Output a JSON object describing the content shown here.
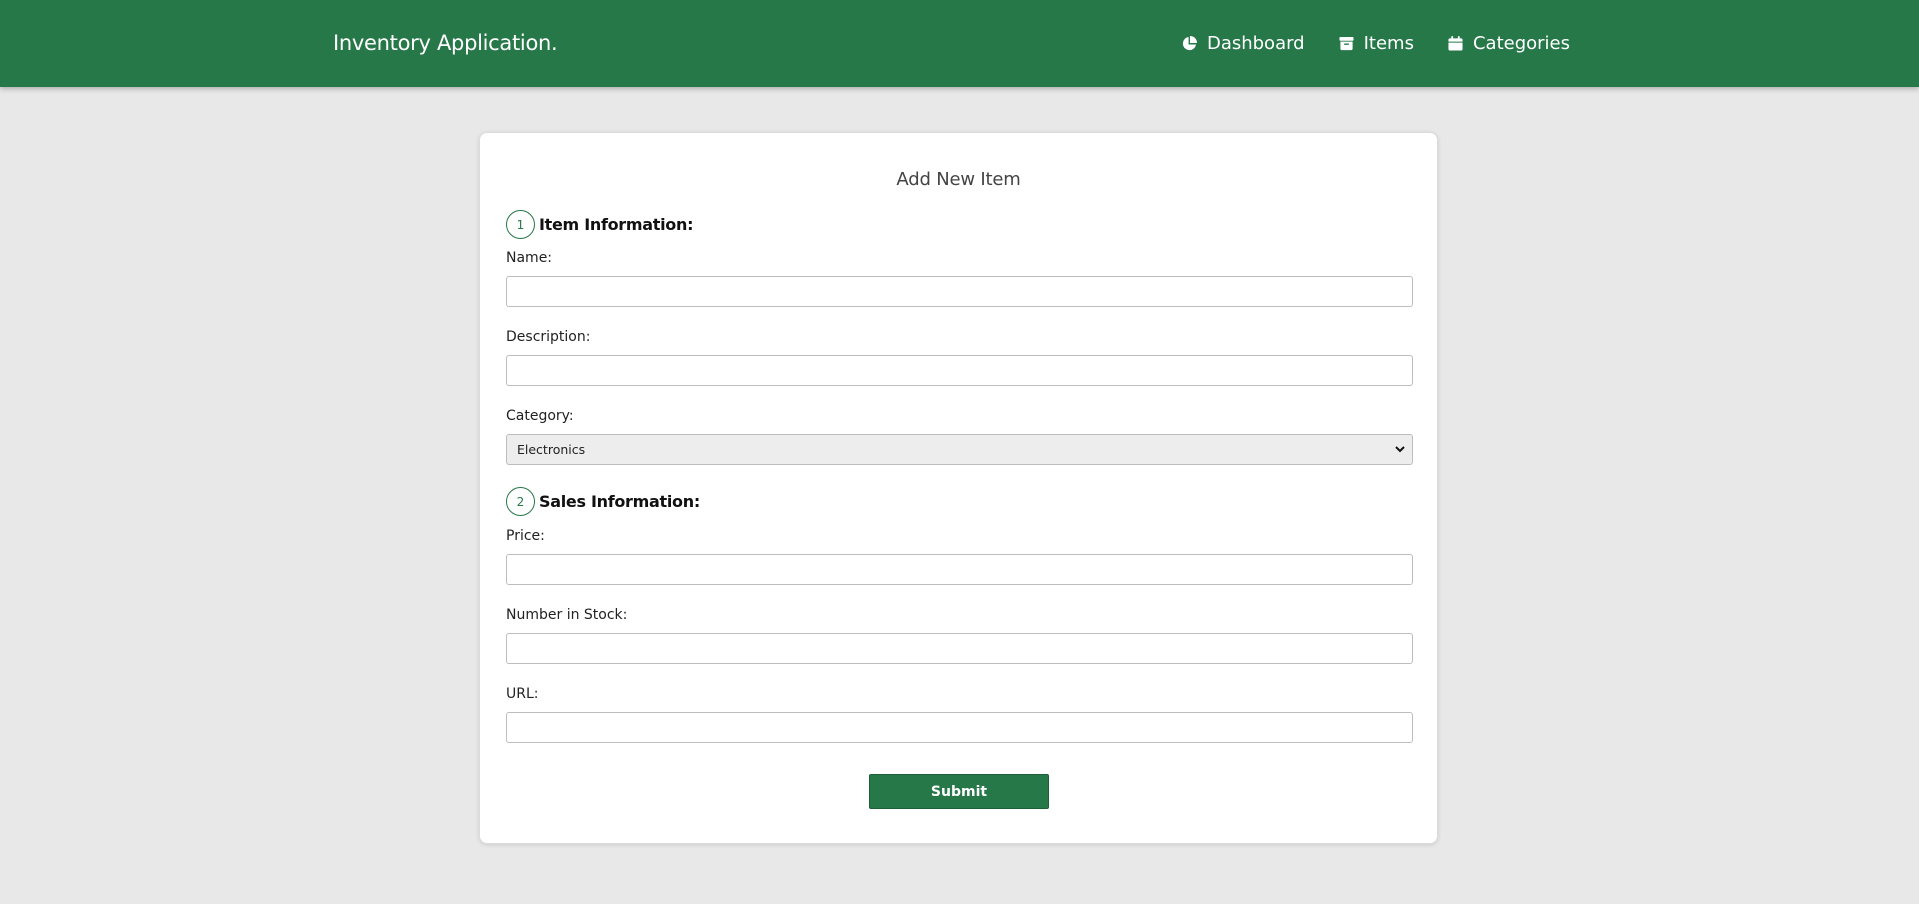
{
  "header": {
    "brand": "Inventory Application.",
    "nav": [
      {
        "label": "Dashboard",
        "icon": "chart-pie-icon"
      },
      {
        "label": "Items",
        "icon": "archive-box-icon"
      },
      {
        "label": "Categories",
        "icon": "calendar-icon"
      }
    ],
    "colors": {
      "primary": "#267849"
    }
  },
  "form": {
    "title": "Add New Item",
    "sections": [
      {
        "number": "1",
        "title": "Item Information:"
      },
      {
        "number": "2",
        "title": "Sales Information:"
      }
    ],
    "fields": {
      "name": {
        "label": "Name:",
        "value": ""
      },
      "description": {
        "label": "Description:",
        "value": ""
      },
      "category": {
        "label": "Category:",
        "selected": "Electronics"
      },
      "price": {
        "label": "Price:",
        "value": ""
      },
      "stock": {
        "label": "Number in Stock:",
        "value": ""
      },
      "url": {
        "label": "URL:",
        "value": ""
      }
    },
    "submit_label": "Submit"
  }
}
